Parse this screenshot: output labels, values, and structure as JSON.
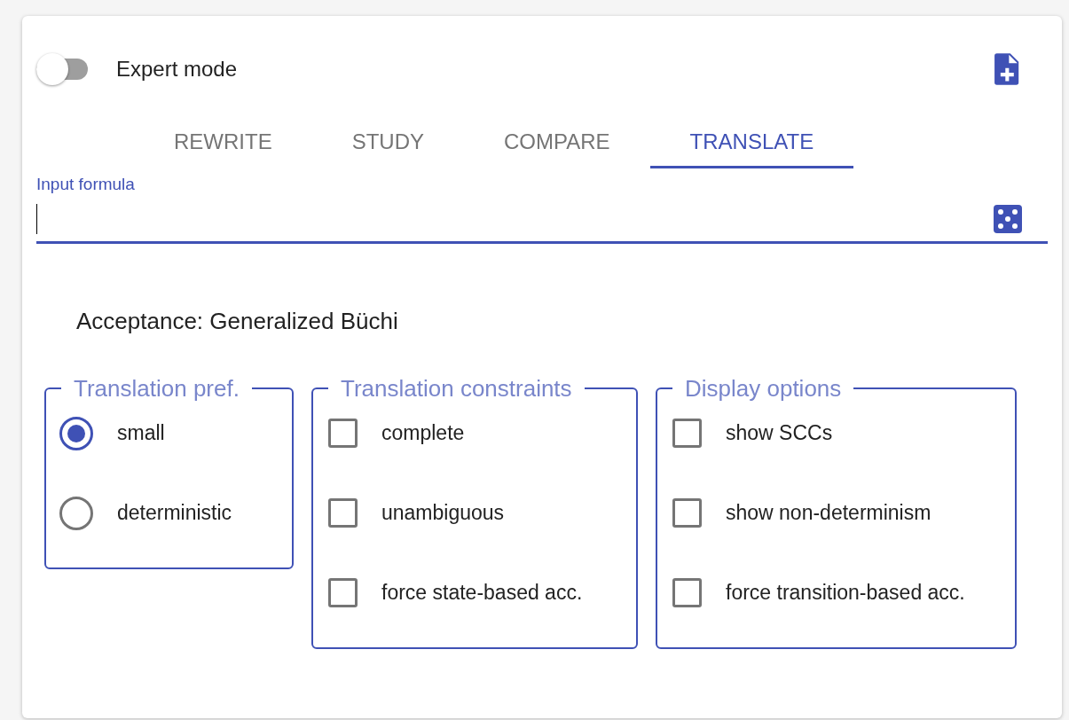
{
  "expert_mode": {
    "label": "Expert mode",
    "on": false
  },
  "tabs": [
    {
      "label": "REWRITE",
      "selected": false
    },
    {
      "label": "STUDY",
      "selected": false
    },
    {
      "label": "COMPARE",
      "selected": false
    },
    {
      "label": "TRANSLATE",
      "selected": true
    }
  ],
  "input": {
    "label": "Input formula"
  },
  "acceptance": "Acceptance: Generalized Büchi",
  "groups": [
    {
      "title": "Translation pref.",
      "kind": "radio",
      "options": [
        {
          "label": "small",
          "selected": true
        },
        {
          "label": "deterministic",
          "selected": false
        }
      ]
    },
    {
      "title": "Translation constraints",
      "kind": "checkbox",
      "options": [
        {
          "label": "complete",
          "checked": false
        },
        {
          "label": "unambiguous",
          "checked": false
        },
        {
          "label": "force state-based acc.",
          "checked": false
        }
      ]
    },
    {
      "title": "Display options",
      "kind": "checkbox",
      "options": [
        {
          "label": "show SCCs",
          "checked": false
        },
        {
          "label": "show non-determinism",
          "checked": false
        },
        {
          "label": "force transition-based acc.",
          "checked": false
        }
      ]
    }
  ]
}
